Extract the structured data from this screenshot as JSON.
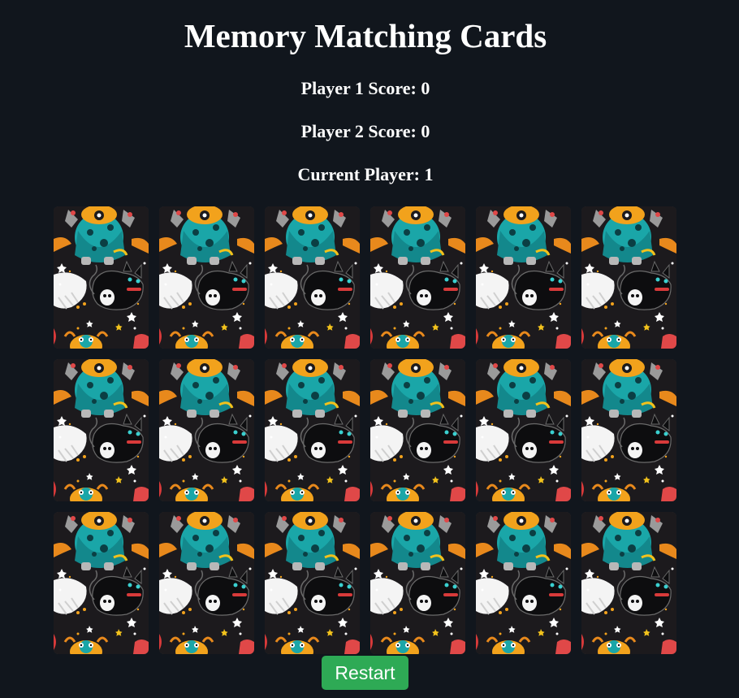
{
  "title": "Memory Matching Cards",
  "scores": {
    "player1": "Player 1 Score: 0",
    "player2": "Player 2 Score: 0",
    "current": "Current Player: 1"
  },
  "board": {
    "rows": 3,
    "columns": 6,
    "card_state": "face-down",
    "card_back_art": "halloween-monster-cat-pattern-icon"
  },
  "restart_label": "Restart",
  "colors": {
    "background": "#11161d",
    "restart_button": "#2eaa55",
    "card_back_base": "#1c1a1d"
  }
}
